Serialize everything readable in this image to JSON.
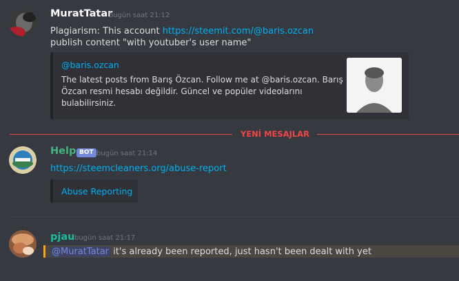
{
  "msg1": {
    "author": "MuratTatar",
    "time": "bugün saat 21:12",
    "line1_prefix": "Plagiarism: This account ",
    "line1_link": "https://steemit.com/@baris.ozcan",
    "line2": "publish content \"with youtuber's user name\"",
    "embed": {
      "provider": "@baris.ozcan",
      "desc1": "The latest posts from Barış Özcan. Follow me at @baris.ozcan. Barış",
      "desc2": "Özcan resmi hesabı değildir. Güncel ve popüler videolarını",
      "desc3": "bulabilirsiniz."
    }
  },
  "divider": {
    "label": "YENİ MESAJLAR",
    "color": "#f04747"
  },
  "msg2": {
    "author": "Help",
    "bot_tag": "BOT",
    "time": "bugün saat 21:14",
    "link": "https://steemcleaners.org/abuse-report",
    "embed_title": "Abuse Reporting"
  },
  "msg3": {
    "author": "pjau",
    "time": "bugün saat 21:17",
    "mention": "@MuratTatar",
    "text": " it's already been reported, just hasn't been dealt with yet"
  },
  "colors": {
    "background": "#36393f",
    "embed_bg": "#2f3136",
    "link": "#00b0f4",
    "help_name": "#43b581",
    "pjau_name": "#1abc9c",
    "mention_bg": "#3f4466",
    "mention_text": "#7289da",
    "highlight_bar": "#faa61a"
  }
}
